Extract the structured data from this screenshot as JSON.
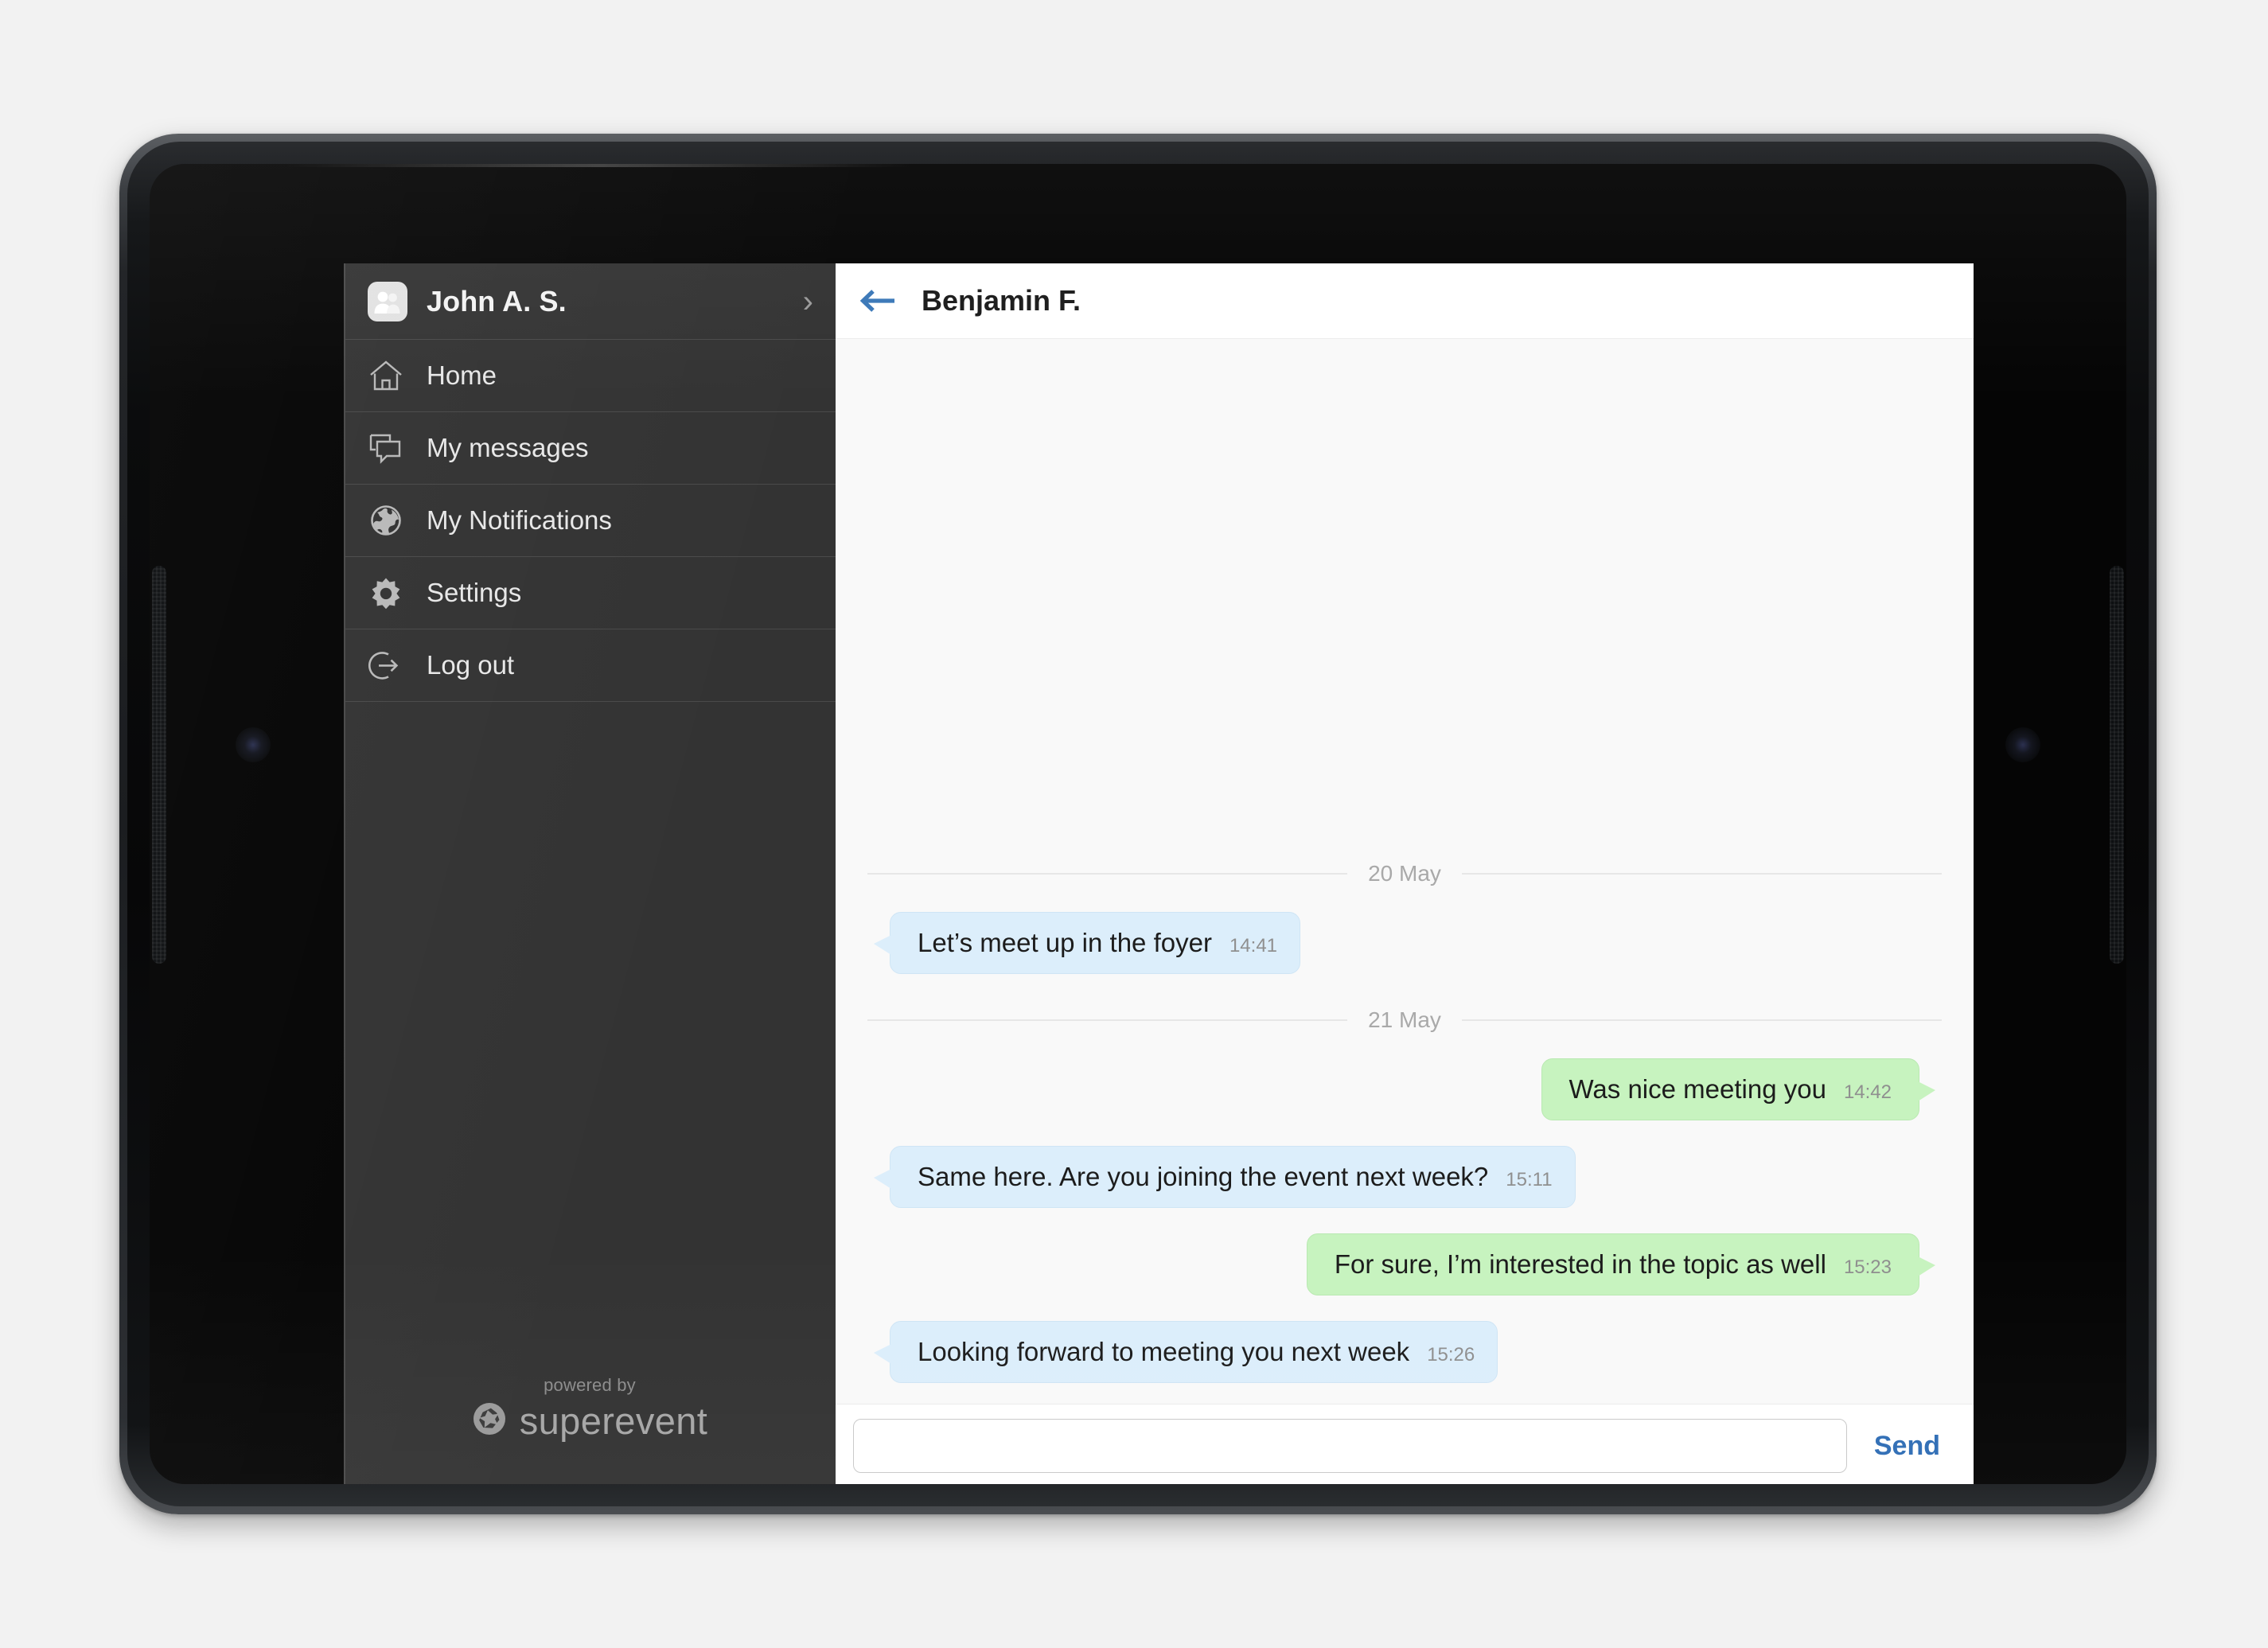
{
  "sidebar": {
    "profile": {
      "name": "John A. S.",
      "avatar_icon": "users-avatar-icon",
      "chevron_icon": "chevron-right-icon"
    },
    "items": [
      {
        "label": "Home",
        "icon": "home-icon"
      },
      {
        "label": "My messages",
        "icon": "speech-bubbles-icon"
      },
      {
        "label": "My Notifications",
        "icon": "globe-icon"
      },
      {
        "label": "Settings",
        "icon": "gear-icon"
      },
      {
        "label": "Log out",
        "icon": "logout-arrow-icon"
      }
    ],
    "footer": {
      "powered_by": "powered by",
      "brand": "superevent",
      "brand_icon": "star-badge-icon"
    }
  },
  "chat": {
    "header": {
      "back_icon": "back-arrow-icon",
      "title": "Benjamin F."
    },
    "threads": [
      {
        "date": "20 May",
        "messages": [
          {
            "direction": "in",
            "text": "Let’s meet up in the foyer",
            "time": "14:41"
          }
        ]
      },
      {
        "date": "21 May",
        "messages": [
          {
            "direction": "out",
            "text": "Was nice meeting you",
            "time": "14:42"
          },
          {
            "direction": "in",
            "text": "Same here. Are you joining the event next week?",
            "time": "15:11"
          },
          {
            "direction": "out",
            "text": "For sure, I’m interested in the topic as well",
            "time": "15:23"
          },
          {
            "direction": "in",
            "text": "Looking forward to meeting you next week",
            "time": "15:26"
          }
        ]
      }
    ],
    "composer": {
      "value": "",
      "placeholder": "",
      "send_label": "Send"
    }
  },
  "colors": {
    "sidebar_bg": "#333333",
    "incoming_bubble": "#dceefb",
    "outgoing_bubble": "#c7f3bf",
    "accent_blue": "#2f6db5",
    "chat_bg": "#f9f9f9"
  }
}
